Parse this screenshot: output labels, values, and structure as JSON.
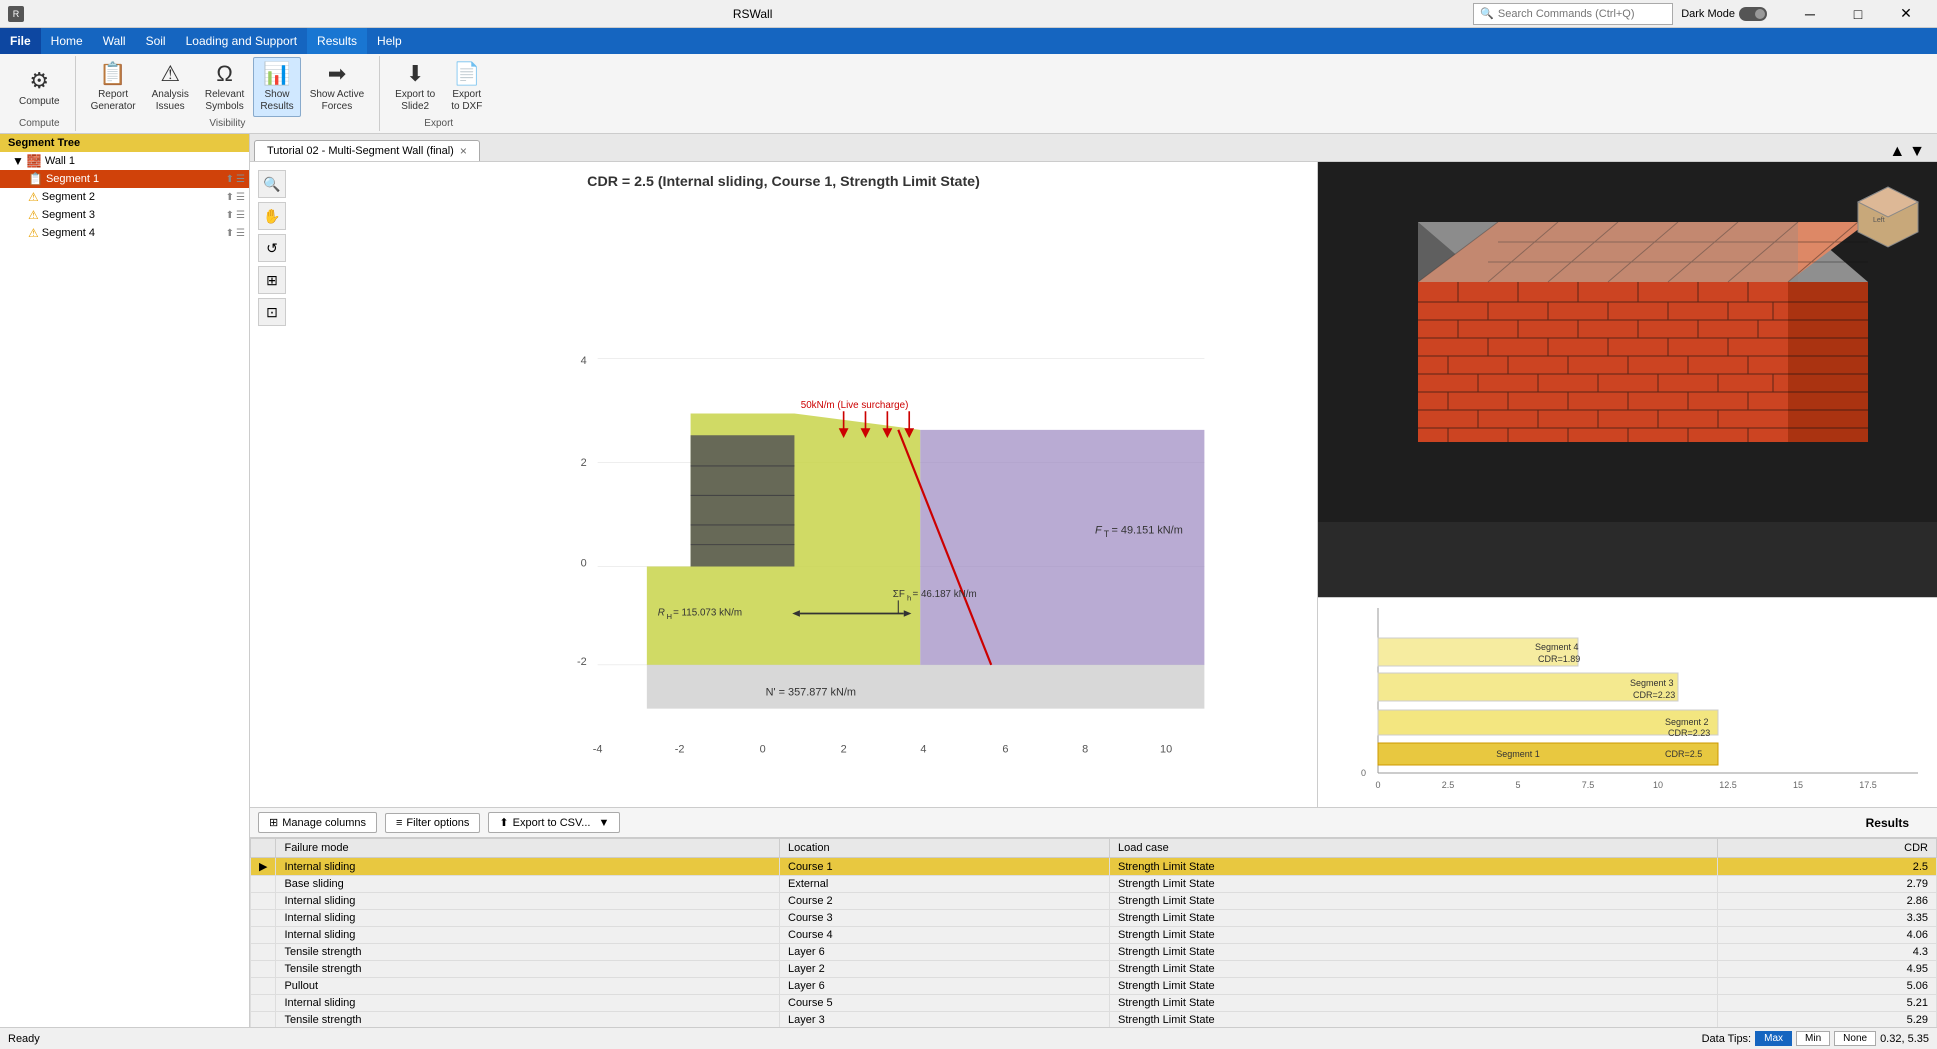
{
  "app": {
    "title": "RSWall",
    "search_placeholder": "Search Commands (Ctrl+Q)"
  },
  "titlebar": {
    "dark_mode_label": "Dark Mode",
    "minimize": "─",
    "maximize": "□",
    "close": "✕"
  },
  "menu": {
    "items": [
      "File",
      "Home",
      "Wall",
      "Soil",
      "Loading and Support",
      "Results",
      "Help"
    ]
  },
  "toolbar": {
    "groups": [
      {
        "label": "Compute",
        "buttons": [
          {
            "id": "compute",
            "icon": "⚙",
            "label": "Compute"
          }
        ]
      },
      {
        "label": "Visibility",
        "buttons": [
          {
            "id": "report-gen",
            "icon": "📋",
            "label": "Report\nGenerator"
          },
          {
            "id": "analysis-issues",
            "icon": "⚠",
            "label": "Analysis\nIssues"
          },
          {
            "id": "relevant-symbols",
            "icon": "🔤",
            "label": "Relevant\nSymbols"
          },
          {
            "id": "show-results",
            "icon": "📊",
            "label": "Show\nResults"
          },
          {
            "id": "show-active-forces",
            "icon": "➡",
            "label": "Show Active\nForces"
          }
        ]
      },
      {
        "label": "Export",
        "buttons": [
          {
            "id": "export-slide2",
            "icon": "⬇",
            "label": "Export to\nSlide2"
          },
          {
            "id": "export-dxf",
            "icon": "📄",
            "label": "Export\nto DXF"
          }
        ]
      }
    ]
  },
  "sidebar": {
    "header": "Segment Tree",
    "items": [
      {
        "id": "wall1",
        "label": "Wall 1",
        "level": 1,
        "icon": "🧱",
        "expand": true
      },
      {
        "id": "seg1",
        "label": "Segment 1",
        "level": 2,
        "selected": true
      },
      {
        "id": "seg2",
        "label": "Segment 2",
        "level": 2,
        "warn": true
      },
      {
        "id": "seg3",
        "label": "Segment 3",
        "level": 2,
        "warn": true
      },
      {
        "id": "seg4",
        "label": "Segment 4",
        "level": 2,
        "warn": true
      }
    ]
  },
  "tab": {
    "label": "Tutorial 02 - Multi-Segment Wall (final)",
    "close": "×"
  },
  "chart": {
    "title": "CDR = 2.5 (Internal sliding, Course 1, Strength Limit State)",
    "surcharge_label": "50kN/m (Live surcharge)",
    "ft_label": "F_T = 49.151 kN/m",
    "rh_label": "R_H = 115.073 kN/m",
    "sum_fh_label": "ΣF_h = 46.187 kN/m",
    "n_label": "N' = 357.877 kN/m"
  },
  "small_chart": {
    "segments": [
      {
        "label": "Segment 4",
        "cdr": "CDR=1.89"
      },
      {
        "label": "Segment 3",
        "cdr": "CDR=2.23"
      },
      {
        "label": "Segment 2",
        "cdr": "CDR=2.23"
      },
      {
        "label": "Segment 1",
        "cdr": "CDR=2.5"
      }
    ]
  },
  "results": {
    "title": "Results",
    "toolbar": {
      "manage_columns": "Manage columns",
      "filter_options": "Filter options",
      "export_csv": "Export to CSV..."
    },
    "columns": [
      "Failure mode",
      "Location",
      "Load case",
      "CDR"
    ],
    "rows": [
      {
        "mode": "Internal sliding",
        "location": "Course 1",
        "load_case": "Strength Limit State",
        "cdr": "2.5",
        "highlighted": true
      },
      {
        "mode": "Base sliding",
        "location": "External",
        "load_case": "Strength Limit State",
        "cdr": "2.79"
      },
      {
        "mode": "Internal sliding",
        "location": "Course 2",
        "load_case": "Strength Limit State",
        "cdr": "2.86"
      },
      {
        "mode": "Internal sliding",
        "location": "Course 3",
        "load_case": "Strength Limit State",
        "cdr": "3.35"
      },
      {
        "mode": "Internal sliding",
        "location": "Course 4",
        "load_case": "Strength Limit State",
        "cdr": "4.06"
      },
      {
        "mode": "Tensile strength",
        "location": "Layer 6",
        "load_case": "Strength Limit State",
        "cdr": "4.3"
      },
      {
        "mode": "Tensile strength",
        "location": "Layer 2",
        "load_case": "Strength Limit State",
        "cdr": "4.95"
      },
      {
        "mode": "Pullout",
        "location": "Layer 6",
        "load_case": "Strength Limit State",
        "cdr": "5.06"
      },
      {
        "mode": "Internal sliding",
        "location": "Course 5",
        "load_case": "Strength Limit State",
        "cdr": "5.21"
      },
      {
        "mode": "Tensile strength",
        "location": "Layer 3",
        "load_case": "Strength Limit State",
        "cdr": "5.29"
      }
    ]
  },
  "statusbar": {
    "status": "Ready",
    "datatips_label": "Data Tips:",
    "max_label": "Max",
    "min_label": "Min",
    "none_label": "None",
    "coords": "0.32, 5.35"
  }
}
